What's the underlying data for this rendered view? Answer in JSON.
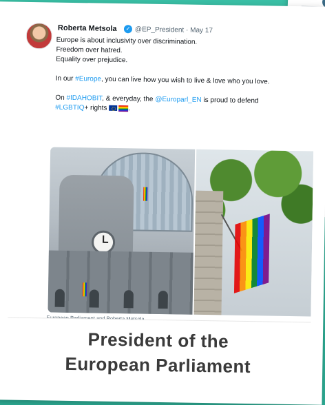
{
  "tweet": {
    "author_name": "Roberta Metsola",
    "handle": "@EP_President",
    "date": "May 17",
    "lines": [
      "Europe is about inclusivity over discrimination.",
      "Freedom over hatred.",
      "Equality over prejudice."
    ],
    "para2_prefix": "In our ",
    "para2_hashtag": "#Europe",
    "para2_suffix": ", you can live how you wish to live & love who you love.",
    "para3_prefix": "On ",
    "para3_hashtag1": "#IDAHOBIT",
    "para3_middle": ", & everyday, the ",
    "para3_mention": "@Europarl_EN",
    "para3_suffix": " is proud to defend",
    "para3_hashtag2": "#LGBTIQ",
    "para3_end": "+ rights",
    "photo_caption": "European Parliament and Roberta Metsola"
  },
  "title_line1": "President of the",
  "title_line2": "European Parliament",
  "colors": {
    "background": "#2fb39a",
    "link": "#1d9bf0",
    "title": "#3a3a3a"
  },
  "icons": [
    "verified-badge-icon",
    "eu-flag-icon",
    "rainbow-flag-icon"
  ]
}
